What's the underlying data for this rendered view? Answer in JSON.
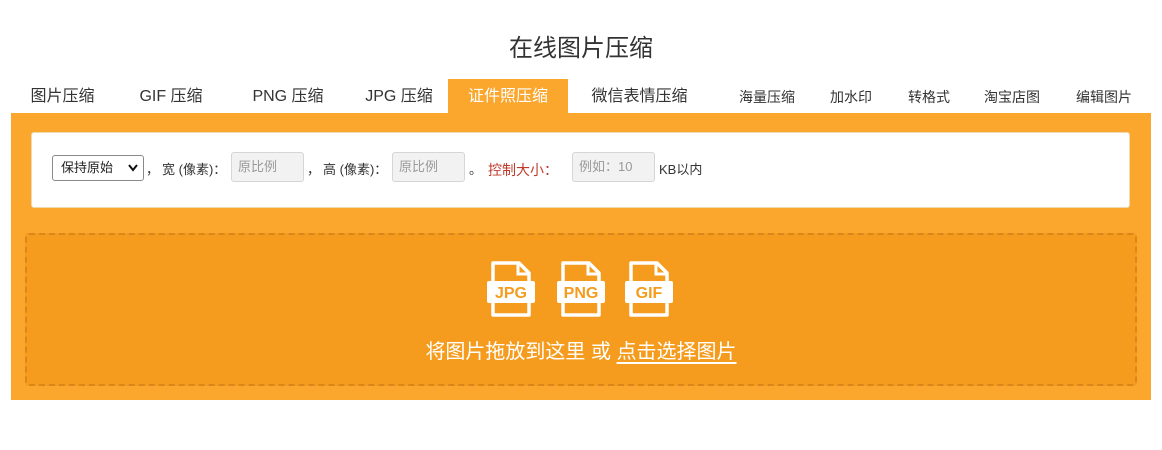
{
  "header": {
    "title": "在线图片压缩"
  },
  "tabs": [
    {
      "label": "图片压缩"
    },
    {
      "label": "GIF 压缩"
    },
    {
      "label": "PNG 压缩"
    },
    {
      "label": "JPG 压缩"
    },
    {
      "label": "证件照压缩"
    },
    {
      "label": "微信表情压缩"
    },
    {
      "label": "海量压缩"
    },
    {
      "label": "加水印"
    },
    {
      "label": "转格式"
    },
    {
      "label": "淘宝店图"
    },
    {
      "label": "编辑图片"
    }
  ],
  "active_tab": "证件照压缩",
  "options": {
    "mode_select_value": "保持原始",
    "comma1": "，",
    "width_label": "宽 (像素)：",
    "width_placeholder": "原比例",
    "comma2": "，",
    "height_label": "高 (像素)：",
    "height_placeholder": "原比例",
    "period": "。",
    "size_label": "控制大小：",
    "size_placeholder": "例如：10",
    "size_unit": "KB以内"
  },
  "dropzone": {
    "icons": [
      {
        "name": "jpg-file-icon",
        "label": "JPG"
      },
      {
        "name": "png-file-icon",
        "label": "PNG"
      },
      {
        "name": "gif-file-icon",
        "label": "GIF"
      }
    ],
    "text": "将图片拖放到这里 或",
    "link": "点击选择图片"
  },
  "colors": {
    "accent": "#fba62d",
    "dropzone": "#f59c1e",
    "size_label": "#c0392b"
  }
}
